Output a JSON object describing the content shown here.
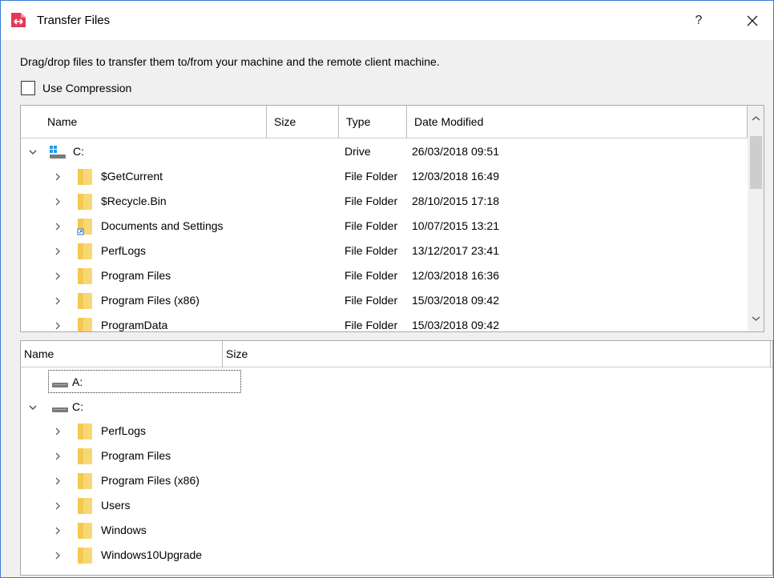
{
  "window": {
    "title": "Transfer Files",
    "help_label": "?",
    "accent_color": "#e5385a"
  },
  "instruction": "Drag/drop files to transfer them to/from your machine and the remote client machine.",
  "compression": {
    "label": "Use Compression",
    "checked": false
  },
  "remote": {
    "columns": [
      "Name",
      "Size",
      "Type",
      "Date Modified"
    ],
    "root": {
      "name": "C:",
      "type": "Drive",
      "date": "26/03/2018 09:51"
    },
    "rows": [
      {
        "name": "$GetCurrent",
        "type": "File Folder",
        "date": "12/03/2018 16:49"
      },
      {
        "name": "$Recycle.Bin",
        "type": "File Folder",
        "date": "28/10/2015 17:18"
      },
      {
        "name": "Documents and Settings",
        "type": "File Folder",
        "date": "10/07/2015 13:21"
      },
      {
        "name": "PerfLogs",
        "type": "File Folder",
        "date": "13/12/2017 23:41"
      },
      {
        "name": "Program Files",
        "type": "File Folder",
        "date": "12/03/2018 16:36"
      },
      {
        "name": "Program Files (x86)",
        "type": "File Folder",
        "date": "15/03/2018 09:42"
      },
      {
        "name": "ProgramData",
        "type": "File Folder",
        "date": "15/03/2018 09:42"
      }
    ]
  },
  "local": {
    "columns": [
      "Name",
      "Size"
    ],
    "drive_a": "A:",
    "drive_c": "C:",
    "rows": [
      {
        "name": "PerfLogs"
      },
      {
        "name": "Program Files"
      },
      {
        "name": "Program Files (x86)"
      },
      {
        "name": "Users"
      },
      {
        "name": "Windows"
      },
      {
        "name": "Windows10Upgrade"
      }
    ]
  }
}
